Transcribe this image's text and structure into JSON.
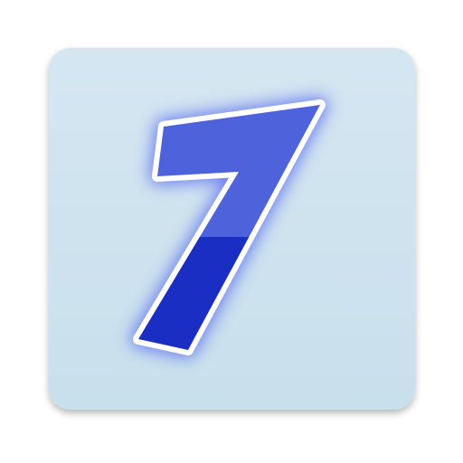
{
  "icon": {
    "semantic": "number-seven-app-icon",
    "glyph": "7",
    "colors": {
      "tile_top": "#d5e6f1",
      "tile_bottom": "#c8e0ec",
      "glyph_light": "#4e62dc",
      "glyph_dark": "#1a2ec4",
      "glyph_outline": "#ffffff",
      "glow": "#4a5cf0",
      "shadow": "#000000"
    }
  }
}
